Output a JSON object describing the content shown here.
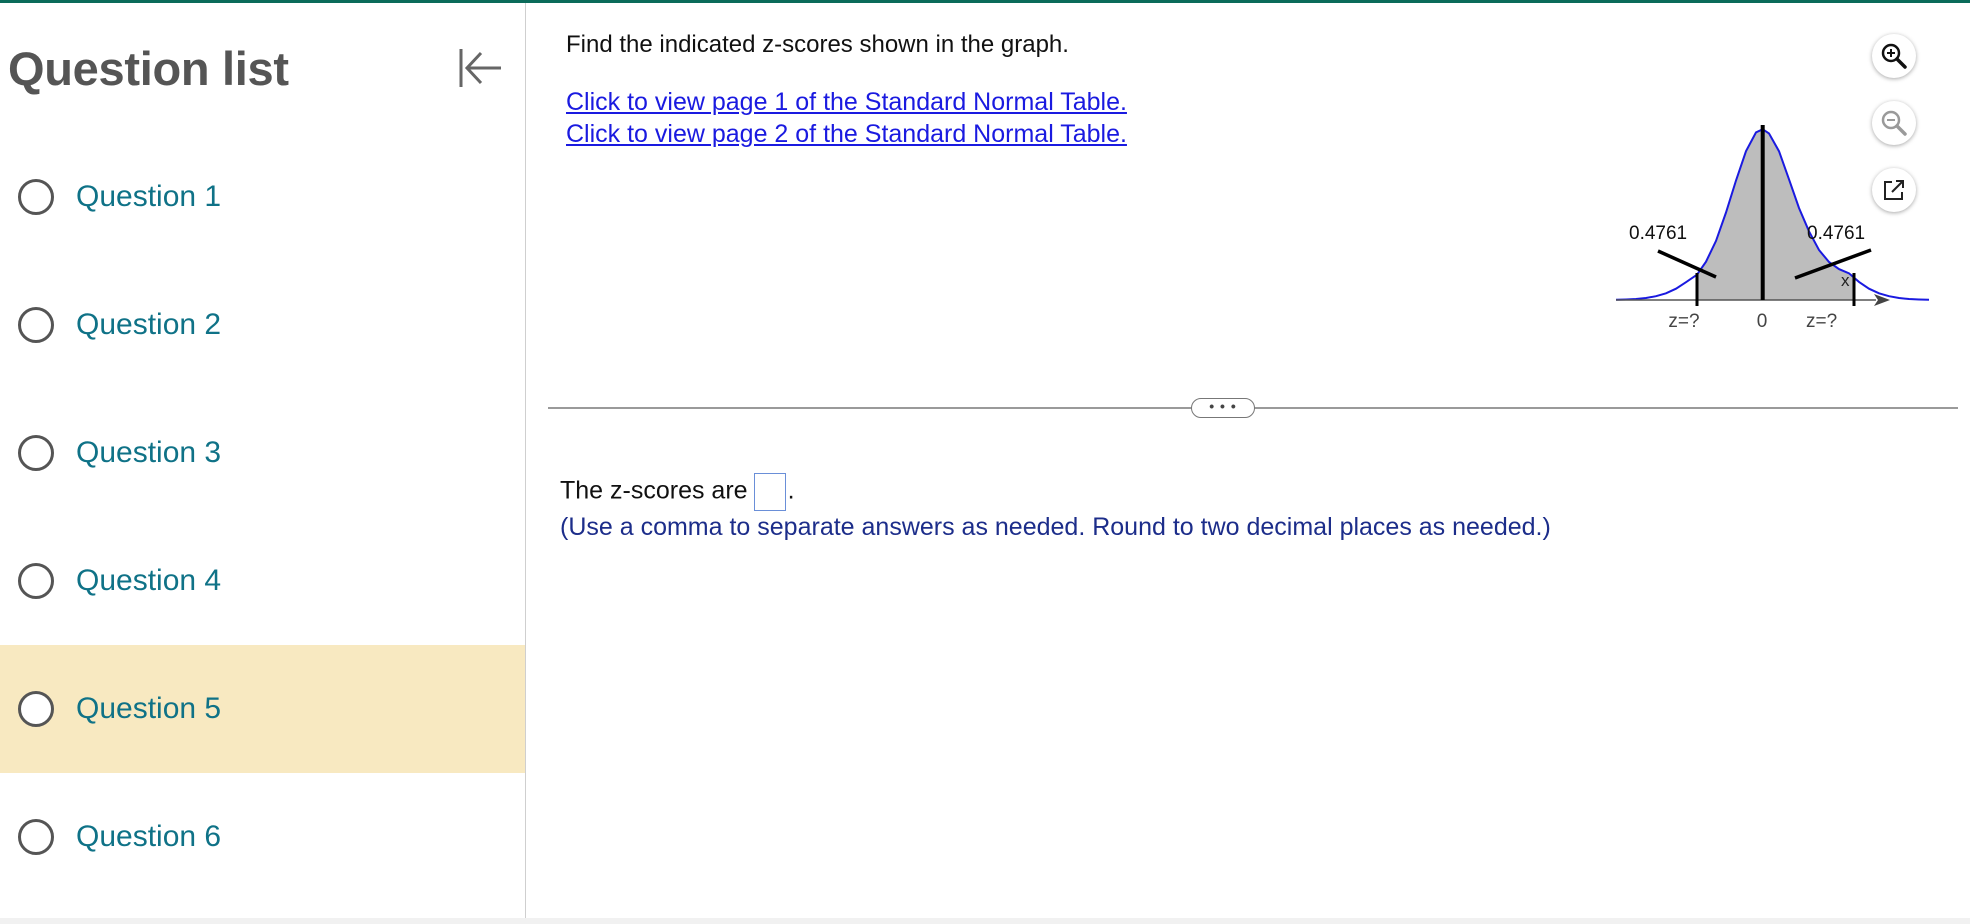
{
  "sidebar": {
    "title": "Question list",
    "items": [
      {
        "label": "Question 1",
        "active": false
      },
      {
        "label": "Question 2",
        "active": false
      },
      {
        "label": "Question 3",
        "active": false
      },
      {
        "label": "Question 4",
        "active": false
      },
      {
        "label": "Question 5",
        "active": true
      },
      {
        "label": "Question 6",
        "active": false
      }
    ]
  },
  "main": {
    "prompt": "Find the indicated z-scores shown in the graph.",
    "link1": "Click to view page 1 of the Standard Normal Table.",
    "link2": "Click to view page 2 of the Standard Normal Table.",
    "graph": {
      "left_area": "0.4761",
      "right_area": "0.4761",
      "axis_label": "x",
      "left_tick": "z=?",
      "center_tick": "0",
      "right_tick": "z=?"
    },
    "divider_handle": "• • •",
    "answer_prefix": "The z-scores are",
    "answer_suffix": ".",
    "answer_hint": "(Use a comma to separate answers as needed. Round to two decimal places as needed.)"
  },
  "tools": {
    "zoom_in": "zoom-in-icon",
    "zoom_out": "zoom-out-icon",
    "popout": "popout-icon"
  },
  "colors": {
    "accent": "#0f7287",
    "link": "#1a1ae0",
    "active_item_bg": "#f8e9c1",
    "hint": "#1c2d8a",
    "curve": "#1a1ae0",
    "shade": "#bdbdbd"
  }
}
